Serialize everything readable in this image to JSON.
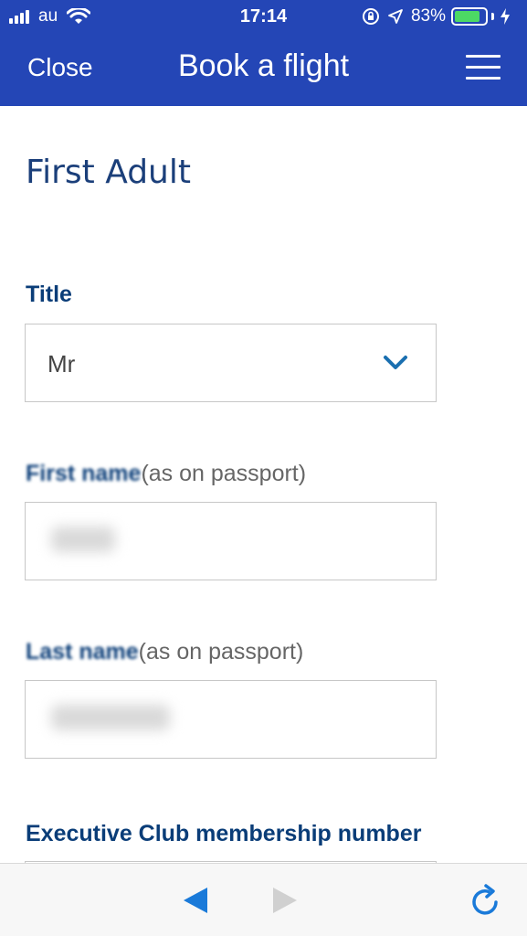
{
  "status_bar": {
    "carrier": "au",
    "time": "17:14",
    "battery_percent": "83%",
    "battery_level": 0.83
  },
  "header": {
    "close_label": "Close",
    "title": "Book a flight"
  },
  "form": {
    "section_title": "First Adult",
    "title_label": "Title",
    "title_value": "Mr",
    "first_name_label": "First name",
    "first_name_hint": "(as on passport)",
    "last_name_label": "Last name",
    "last_name_hint": "(as on passport)",
    "membership_label": "Executive Club membership number"
  },
  "colors": {
    "header_bg": "#2446b6",
    "heading_text": "#0a3d78",
    "accent": "#1a7ad9"
  },
  "icons": {
    "menu": "hamburger-menu-icon",
    "dropdown": "chevron-down-icon",
    "back": "back-arrow-icon",
    "forward": "forward-arrow-icon",
    "reload": "reload-icon"
  }
}
